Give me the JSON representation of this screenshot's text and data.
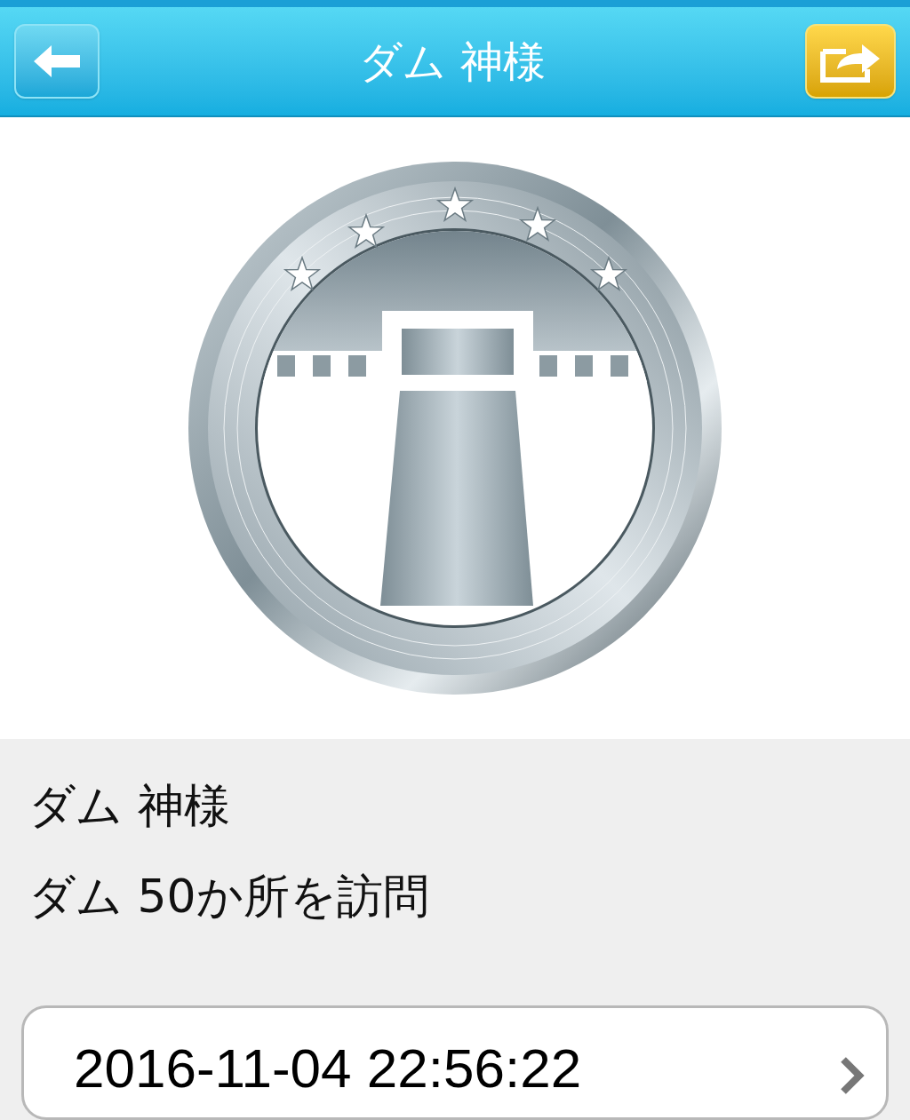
{
  "header": {
    "title": "ダム 神様"
  },
  "badge": {
    "name": "ダム 神様",
    "description": "ダム 50か所を訪問"
  },
  "date_row": {
    "text": "2016-11-04 22:56:22"
  }
}
